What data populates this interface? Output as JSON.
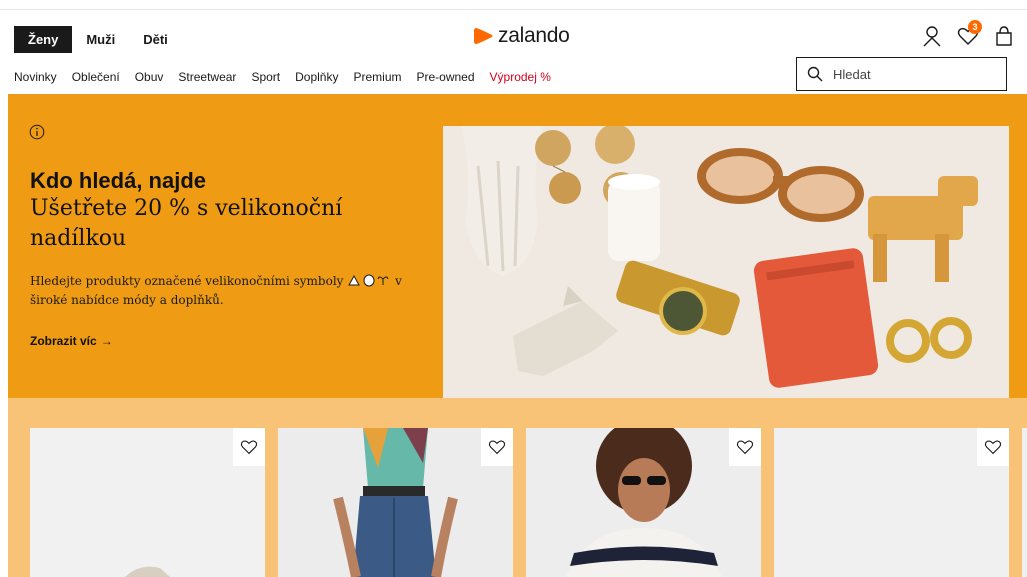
{
  "header": {
    "gender_tabs": [
      "Ženy",
      "Muži",
      "Děti"
    ],
    "logo_text": "zalando",
    "wishlist_count": "3",
    "icons": [
      "user-icon",
      "heart-icon",
      "bag-icon"
    ]
  },
  "nav": {
    "items": [
      "Novinky",
      "Oblečení",
      "Obuv",
      "Streetwear",
      "Sport",
      "Doplňky",
      "Premium",
      "Pre-owned"
    ],
    "sale": "Výprodej %"
  },
  "search": {
    "placeholder": "Hledat"
  },
  "hero": {
    "title": "Kdo hledá, najde",
    "subtitle": "Ušetřete 20 % s velikonoční nadílkou",
    "description_before": "Hledejte produkty označené velikonočními symboly",
    "description_after": "v široké nabídce módy a doplňků.",
    "link": "Zobrazit víc",
    "link_arrow": "→"
  },
  "products": {
    "count": 4
  },
  "colors": {
    "brand_orange": "#ff6900",
    "hero_bg": "#ef9c14",
    "products_bg": "#f8c377",
    "sale_red": "#d0021b"
  }
}
